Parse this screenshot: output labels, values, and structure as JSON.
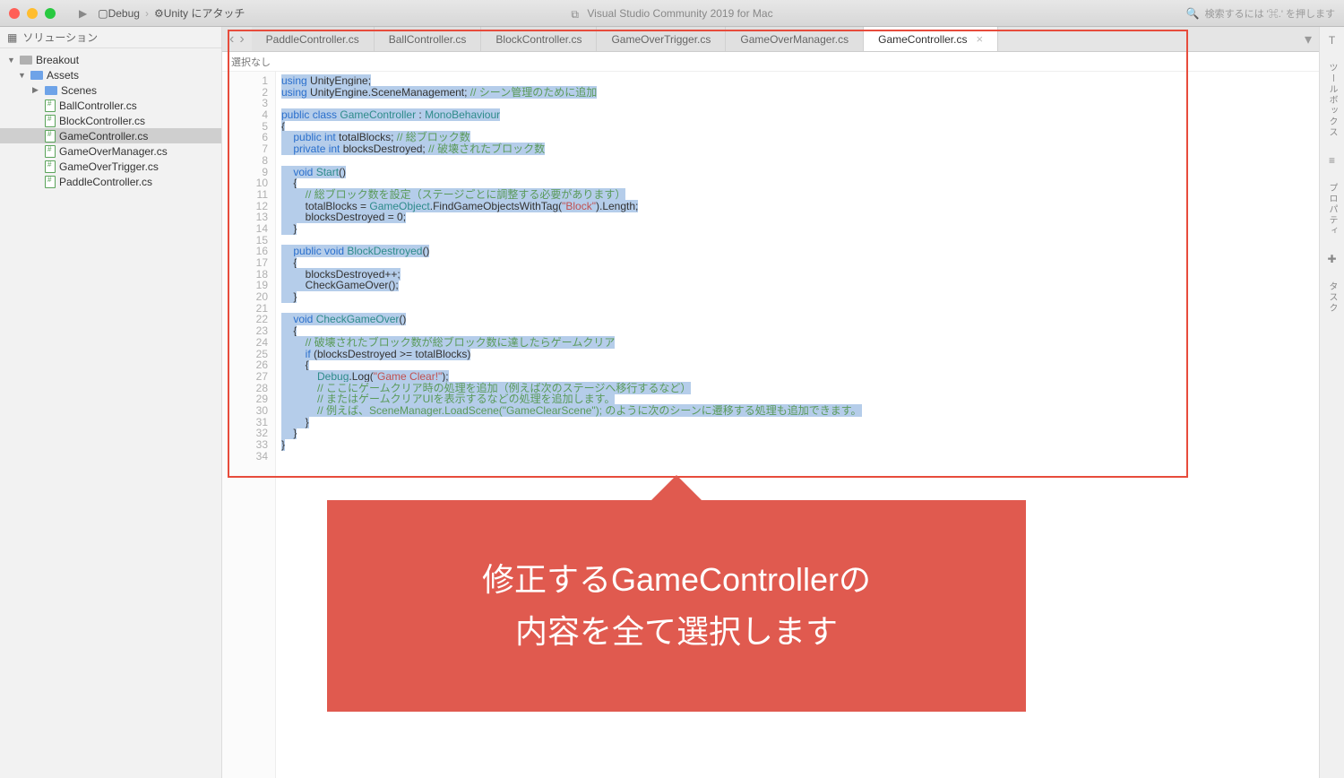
{
  "titlebar": {
    "debug": "Debug",
    "unity_attach": "Unity にアタッチ",
    "app_title": "Visual Studio Community 2019 for Mac",
    "search_hint": "検索するには '⌘.' を押します"
  },
  "solution_panel": {
    "header": "ソリューション",
    "root": "Breakout",
    "assets": "Assets",
    "scenes": "Scenes",
    "files": [
      "BallController.cs",
      "BlockController.cs",
      "GameController.cs",
      "GameOverManager.cs",
      "GameOverTrigger.cs",
      "PaddleController.cs"
    ],
    "selected_index": 2
  },
  "tabs": [
    "PaddleController.cs",
    "BallController.cs",
    "BlockController.cs",
    "GameOverTrigger.cs",
    "GameOverManager.cs",
    "GameController.cs"
  ],
  "active_tab_index": 5,
  "breadcrumb": "選択なし",
  "line_count": 34,
  "code_lines": [
    [
      [
        "kw",
        "using"
      ],
      [
        "",
        " UnityEngine;"
      ]
    ],
    [
      [
        "kw",
        "using"
      ],
      [
        "",
        " UnityEngine.SceneManagement; "
      ],
      [
        "cm",
        "// シーン管理のために追加"
      ]
    ],
    [
      [
        "",
        ""
      ]
    ],
    [
      [
        "kw",
        "public class"
      ],
      [
        "",
        " "
      ],
      [
        "type",
        "GameController"
      ],
      [
        "",
        " : "
      ],
      [
        "type",
        "MonoBehaviour"
      ]
    ],
    [
      [
        "",
        "{"
      ]
    ],
    [
      [
        "",
        "    "
      ],
      [
        "kw",
        "public int"
      ],
      [
        "",
        " totalBlocks; "
      ],
      [
        "cm",
        "// 総ブロック数"
      ]
    ],
    [
      [
        "",
        "    "
      ],
      [
        "kw",
        "private int"
      ],
      [
        "",
        " blocksDestroyed; "
      ],
      [
        "cm",
        "// 破壊されたブロック数"
      ]
    ],
    [
      [
        "",
        ""
      ]
    ],
    [
      [
        "",
        "    "
      ],
      [
        "kw",
        "void"
      ],
      [
        "",
        " "
      ],
      [
        "type",
        "Start"
      ],
      [
        "",
        "()"
      ]
    ],
    [
      [
        "",
        "    {"
      ]
    ],
    [
      [
        "",
        "        "
      ],
      [
        "cm",
        "// 総ブロック数を設定（ステージごとに調整する必要があります）"
      ]
    ],
    [
      [
        "",
        "        totalBlocks = "
      ],
      [
        "type",
        "GameObject"
      ],
      [
        "",
        ".FindGameObjectsWithTag("
      ],
      [
        "str",
        "\"Block\""
      ],
      [
        "",
        ").Length;"
      ]
    ],
    [
      [
        "",
        "        blocksDestroyed = 0;"
      ]
    ],
    [
      [
        "",
        "    }"
      ]
    ],
    [
      [
        "",
        ""
      ]
    ],
    [
      [
        "",
        "    "
      ],
      [
        "kw",
        "public void"
      ],
      [
        "",
        " "
      ],
      [
        "type",
        "BlockDestroyed"
      ],
      [
        "",
        "()"
      ]
    ],
    [
      [
        "",
        "    {"
      ]
    ],
    [
      [
        "",
        "        blocksDestroyed++;"
      ]
    ],
    [
      [
        "",
        "        CheckGameOver();"
      ]
    ],
    [
      [
        "",
        "    }"
      ]
    ],
    [
      [
        "",
        ""
      ]
    ],
    [
      [
        "",
        "    "
      ],
      [
        "kw",
        "void"
      ],
      [
        "",
        " "
      ],
      [
        "type",
        "CheckGameOver"
      ],
      [
        "",
        "()"
      ]
    ],
    [
      [
        "",
        "    {"
      ]
    ],
    [
      [
        "",
        "        "
      ],
      [
        "cm",
        "// 破壊されたブロック数が総ブロック数に達したらゲームクリア"
      ]
    ],
    [
      [
        "",
        "        "
      ],
      [
        "kw",
        "if"
      ],
      [
        "",
        " (blocksDestroyed >= totalBlocks)"
      ]
    ],
    [
      [
        "",
        "        {"
      ]
    ],
    [
      [
        "",
        "            "
      ],
      [
        "type",
        "Debug"
      ],
      [
        "",
        ".Log("
      ],
      [
        "str",
        "\"Game Clear!\""
      ],
      [
        "",
        ");"
      ]
    ],
    [
      [
        "",
        "            "
      ],
      [
        "cm",
        "// ここにゲームクリア時の処理を追加（例えば次のステージへ移行するなど）"
      ]
    ],
    [
      [
        "",
        "            "
      ],
      [
        "cm",
        "// またはゲームクリアUIを表示するなどの処理を追加します。"
      ]
    ],
    [
      [
        "",
        "            "
      ],
      [
        "cm",
        "// 例えば、SceneManager.LoadScene(\"GameClearScene\"); のように次のシーンに遷移する処理も追加できます。"
      ]
    ],
    [
      [
        "",
        "        }"
      ]
    ],
    [
      [
        "",
        "    }"
      ]
    ],
    [
      [
        "",
        "}"
      ]
    ],
    [
      [
        "",
        ""
      ]
    ]
  ],
  "highlighted_lines_end": 33,
  "callout": {
    "line1": "修正するGameControllerの",
    "line2": "内容を全て選択します"
  },
  "rightrail": {
    "toolbox": "ツールボックス",
    "properties": "プロパティ",
    "tasks": "タスク"
  }
}
